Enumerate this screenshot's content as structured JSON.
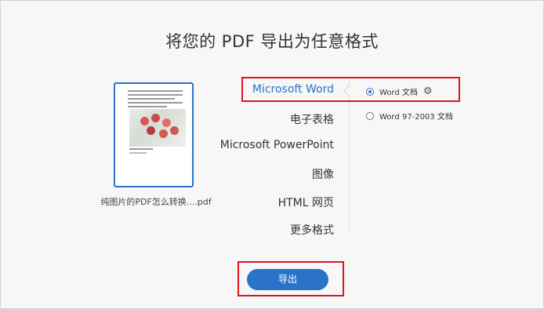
{
  "title": "将您的 PDF 导出为任意格式",
  "file": {
    "name": "纯图片的PDF怎么转换....pdf"
  },
  "formats": [
    {
      "label": "Microsoft Word",
      "active": true
    },
    {
      "label": "电子表格",
      "active": false
    },
    {
      "label": "Microsoft PowerPoint",
      "active": false
    },
    {
      "label": "图像",
      "active": false
    },
    {
      "label": "HTML 网页",
      "active": false
    },
    {
      "label": "更多格式",
      "active": false
    }
  ],
  "options": [
    {
      "label": "Word 文档",
      "selected": true,
      "icon": "gear-icon"
    },
    {
      "label": "Word 97-2003 文档",
      "selected": false
    }
  ],
  "export_button": {
    "label": "导出"
  },
  "colors": {
    "accent": "#2a73c9",
    "highlight": "#e0141e",
    "background": "#f7f7f7"
  }
}
